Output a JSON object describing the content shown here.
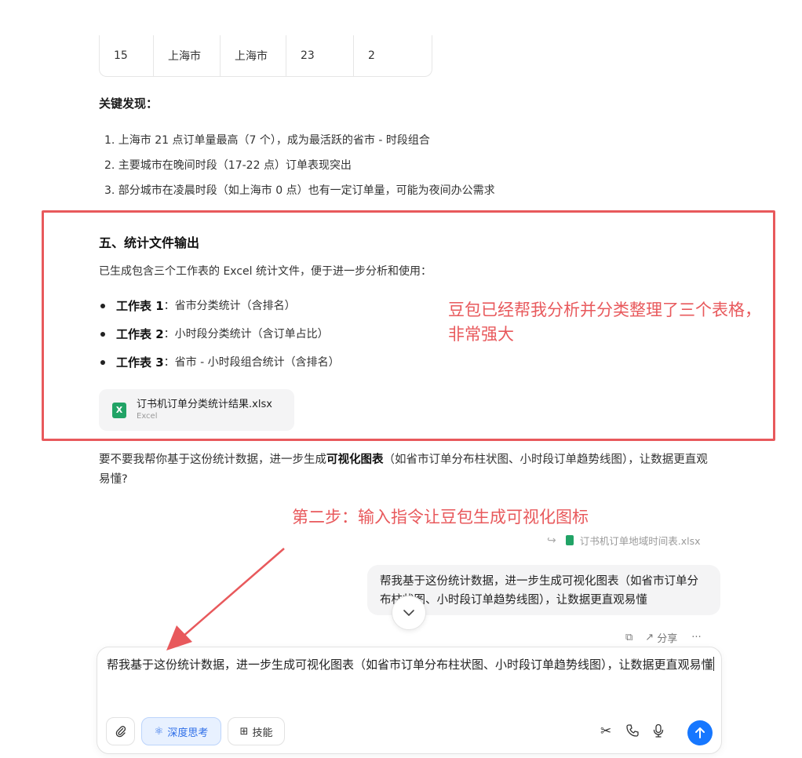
{
  "table_row": [
    "15",
    "上海市",
    "上海市",
    "23",
    "2"
  ],
  "findings": {
    "title": "关键发现：",
    "items": [
      "1. 上海市 21 点订单量最高（7 个），成为最活跃的省市 - 时段组合",
      "2. 主要城市在晚间时段（17-22 点）订单表现突出",
      "3. 部分城市在凌晨时段（如上海市 0 点）也有一定订单量，可能为夜间办公需求"
    ]
  },
  "section": {
    "title": "五、统计文件输出",
    "desc": "已生成包含三个工作表的 Excel 统计文件，便于进一步分析和使用：",
    "sheets": [
      {
        "name": "工作表 1",
        "desc": "：省市分类统计（含排名）"
      },
      {
        "name": "工作表 2",
        "desc": "：小时段分类统计（含订单占比）"
      },
      {
        "name": "工作表 3",
        "desc": "：省市 - 小时段组合统计（含排名）"
      }
    ]
  },
  "file": {
    "icon": "X",
    "name": "订书机订单分类统计结果.xlsx",
    "type": "Excel"
  },
  "annotation": "豆包已经帮我分析并分类整理了三个表格，非常强大",
  "followup": {
    "before": "要不要我帮你基于这份统计数据，进一步生成",
    "bold": "可视化图表",
    "after": "（如省市订单分布柱状图、小时段订单趋势线图），让数据更直观易懂?"
  },
  "step2": "第二步：输入指令让豆包生成可视化图标",
  "attachment": "订书机订单地域时间表.xlsx",
  "user_message": "帮我基于这份统计数据，进一步生成可视化图表（如省市订单分布柱状图、小时段订单趋势线图），让数据更直观易懂",
  "message_actions": {
    "share": "分享"
  },
  "composer": {
    "text": "帮我基于这份统计数据，进一步生成可视化图表（如省市订单分布柱状图、小时段订单趋势线图），让数据更直观易懂",
    "deep_think": "深度思考",
    "skills": "技能"
  },
  "colors": {
    "annotation": "#e8595c",
    "accent": "#1677ff",
    "excel": "#21a366"
  }
}
